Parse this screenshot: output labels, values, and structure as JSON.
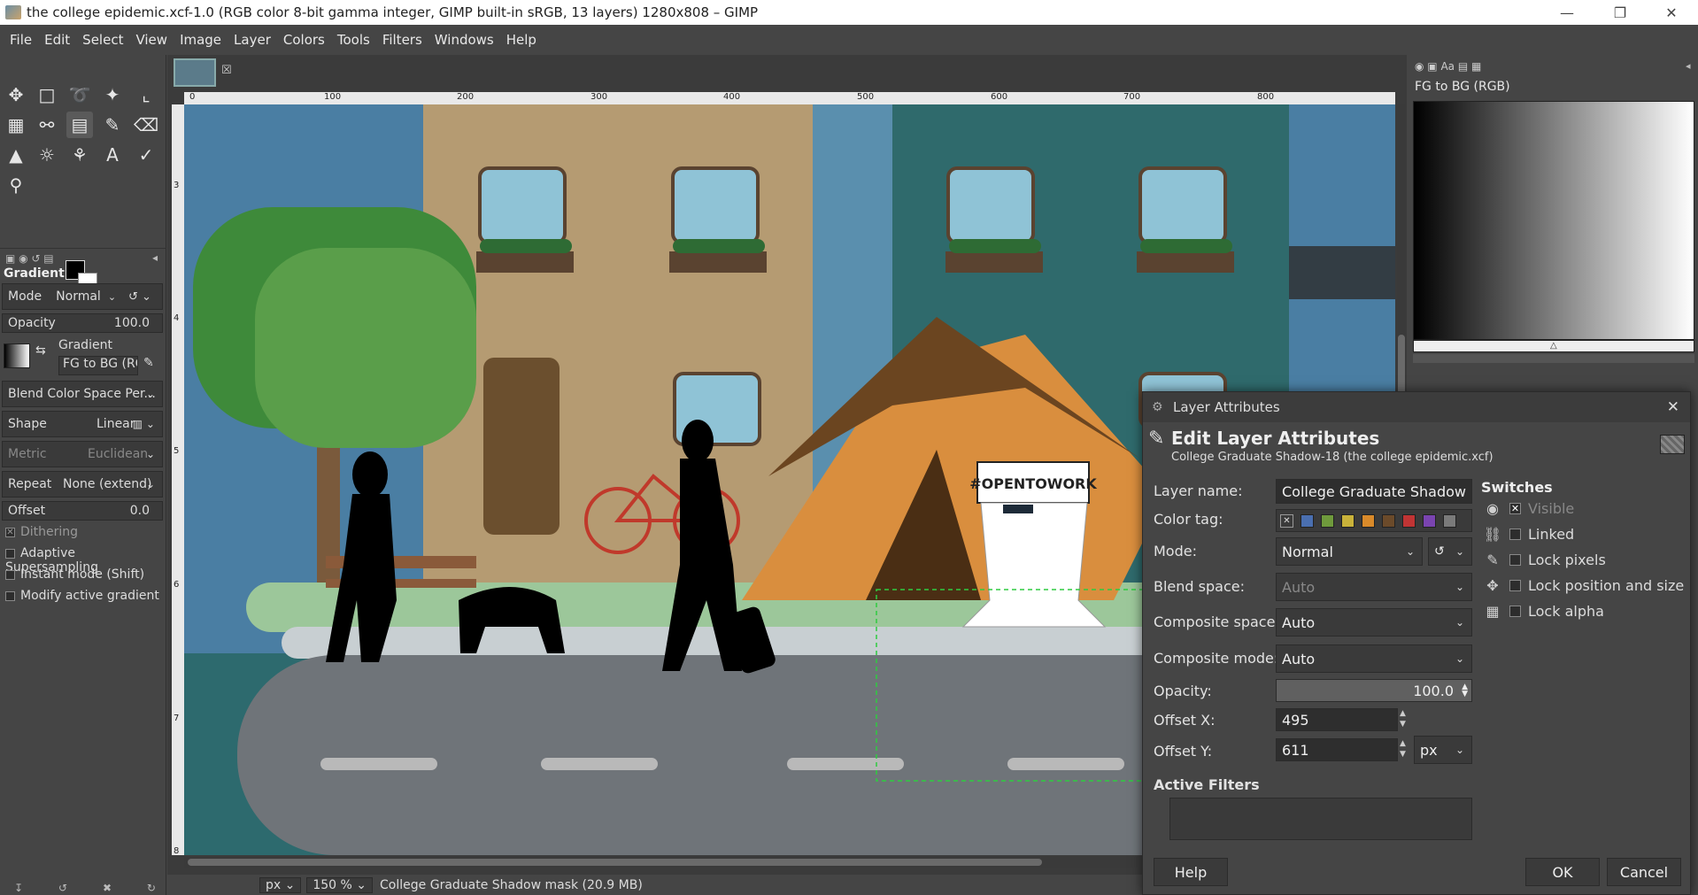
{
  "window": {
    "title": "the college epidemic.xcf-1.0 (RGB color 8-bit gamma integer, GIMP built-in sRGB, 13 layers) 1280x808 – GIMP"
  },
  "menubar": [
    "File",
    "Edit",
    "Select",
    "View",
    "Image",
    "Layer",
    "Colors",
    "Tools",
    "Filters",
    "Windows",
    "Help"
  ],
  "tool_options": {
    "title": "Gradient",
    "mode_label": "Mode",
    "mode_value": "Normal",
    "opacity_label": "Opacity",
    "opacity_value": "100.0",
    "gradient_label": "Gradient",
    "gradient_value": "FG to BG (RG",
    "blend_space": "Blend Color Space Per...",
    "shape_label": "Shape",
    "shape_value": "Linear",
    "metric_label": "Metric",
    "metric_value": "Euclidean",
    "repeat_label": "Repeat",
    "repeat_value": "None (extend)",
    "offset_label": "Offset",
    "offset_value": "0.0",
    "checks": [
      {
        "label": "Dithering",
        "checked": true
      },
      {
        "label": "Adaptive Supersampling",
        "checked": false
      },
      {
        "label": "Instant mode  (Shift)",
        "checked": false
      },
      {
        "label": "Modify active gradient",
        "checked": false
      }
    ]
  },
  "rulers": {
    "h_ticks": [
      "0",
      "100",
      "200",
      "300",
      "400",
      "500",
      "600",
      "700",
      "800"
    ],
    "v_ticks": [
      "3",
      "4",
      "5",
      "6",
      "7",
      "8"
    ]
  },
  "canvas": {
    "sign_text": "#OPENTOWORK"
  },
  "statusbar": {
    "unit": "px",
    "zoom": "150 %",
    "message": "College Graduate Shadow mask (20.9 MB)"
  },
  "dock": {
    "gradient_name": "FG to BG (RGB)"
  },
  "dialog": {
    "window_title": "Layer Attributes",
    "heading": "Edit Layer Attributes",
    "subheading": "College Graduate Shadow-18 (the college epidemic.xcf)",
    "layer_name_label": "Layer name:",
    "layer_name_value": "College Graduate Shadow",
    "color_tag_label": "Color tag:",
    "color_tags": [
      "#4a6fb0",
      "#6f9a3c",
      "#c9b23a",
      "#d98a2a",
      "#6b4a2a",
      "#c03434",
      "#7a44b0",
      "#7a7a7a"
    ],
    "mode_label": "Mode:",
    "mode_value": "Normal",
    "blend_space_label": "Blend space:",
    "blend_space_value": "Auto",
    "composite_space_label": "Composite space:",
    "composite_space_value": "Auto",
    "composite_mode_label": "Composite mode:",
    "composite_mode_value": "Auto",
    "opacity_label": "Opacity:",
    "opacity_value": "100.0",
    "offset_x_label": "Offset X:",
    "offset_x_value": "495",
    "offset_y_label": "Offset Y:",
    "offset_y_value": "611",
    "unit_value": "px",
    "active_filters_label": "Active Filters",
    "switches_label": "Switches",
    "switches": [
      {
        "label": "Visible",
        "checked": true,
        "icon": "eye-icon"
      },
      {
        "label": "Linked",
        "checked": false,
        "icon": "chain-icon"
      },
      {
        "label": "Lock pixels",
        "checked": false,
        "icon": "brush-icon"
      },
      {
        "label": "Lock position and size",
        "checked": false,
        "icon": "move-icon"
      },
      {
        "label": "Lock alpha",
        "checked": false,
        "icon": "checker-icon"
      }
    ],
    "help_button": "Help",
    "ok_button": "OK",
    "cancel_button": "Cancel"
  }
}
